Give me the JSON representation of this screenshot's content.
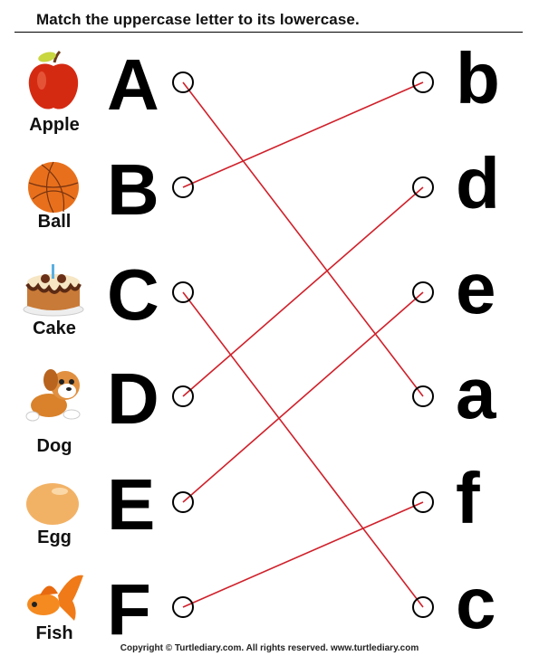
{
  "title": "Match the uppercase letter to its lowercase.",
  "line_color": "#d0202a",
  "left_items": [
    {
      "word": "Apple",
      "letter": "A",
      "icon": "apple-icon"
    },
    {
      "word": "Ball",
      "letter": "B",
      "icon": "ball-icon"
    },
    {
      "word": "Cake",
      "letter": "C",
      "icon": "cake-icon"
    },
    {
      "word": "Dog",
      "letter": "D",
      "icon": "dog-icon"
    },
    {
      "word": "Egg",
      "letter": "E",
      "icon": "egg-icon"
    },
    {
      "word": "Fish",
      "letter": "F",
      "icon": "fish-icon"
    }
  ],
  "right_letters": [
    "b",
    "d",
    "e",
    "a",
    "f",
    "c"
  ],
  "matches": [
    [
      0,
      3
    ],
    [
      1,
      0
    ],
    [
      2,
      5
    ],
    [
      3,
      1
    ],
    [
      4,
      2
    ],
    [
      5,
      4
    ]
  ],
  "copyright": "Copyright © Turtlediary.com. All rights reserved. www.turtlediary.com"
}
